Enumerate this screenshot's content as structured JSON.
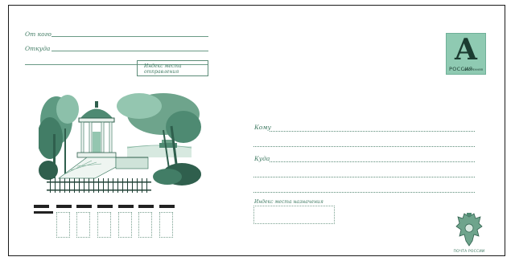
{
  "sender": {
    "from_label": "От кого",
    "from_where_label": "Откуда",
    "index_label": "Индекс места отправления"
  },
  "recipient": {
    "to_label": "Кому",
    "to_where_label": "Куда",
    "index_label": "Индекс места назначения"
  },
  "stamp": {
    "letter": "А",
    "country": "РОССИЯ",
    "denomination": "ВНУТРЕННЯЯ"
  },
  "postal": {
    "service_label": "ПОЧТА РОССИИ"
  },
  "colors": {
    "print_green": "#3f7a62",
    "stamp_green": "#8fcab2"
  }
}
